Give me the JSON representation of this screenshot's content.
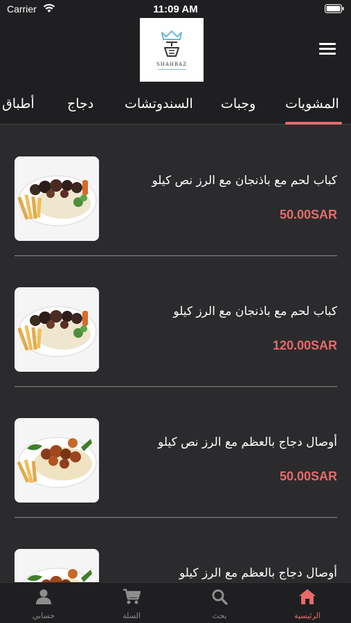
{
  "status_bar": {
    "carrier": "Carrier",
    "time": "11:09 AM"
  },
  "header": {
    "logo_text": "SHAHBAZ",
    "menu_icon": "hamburger-icon"
  },
  "tabs": [
    {
      "label": "المشويات",
      "active": true
    },
    {
      "label": "وجبات",
      "active": false
    },
    {
      "label": "السندوتشات",
      "active": false
    },
    {
      "label": "دجاج",
      "active": false
    },
    {
      "label": "أطباق",
      "active": false
    }
  ],
  "items": [
    {
      "title": "كباب لحم مع باذنجان مع الرز نص كيلو",
      "price": "50.00SAR",
      "image": "kebab"
    },
    {
      "title": "كباب لحم مع باذنجان مع الرز كيلو",
      "price": "120.00SAR",
      "image": "kebab"
    },
    {
      "title": "أوصال دجاج بالعظم مع الرز نص كيلو",
      "price": "50.00SAR",
      "image": "chicken"
    },
    {
      "title": "أوصال دجاج بالعظم مع الرز كيلو",
      "price": "",
      "image": "chicken"
    }
  ],
  "bottom_nav": [
    {
      "label": "الرئيسية",
      "icon": "home-icon",
      "active": true
    },
    {
      "label": "بحث",
      "icon": "search-icon",
      "active": false
    },
    {
      "label": "السلة",
      "icon": "cart-icon",
      "active": false
    },
    {
      "label": "حسابي",
      "icon": "user-icon",
      "active": false
    }
  ],
  "colors": {
    "accent": "#e86a6a",
    "background": "#2b2b2d",
    "bar": "#1f1f21"
  }
}
